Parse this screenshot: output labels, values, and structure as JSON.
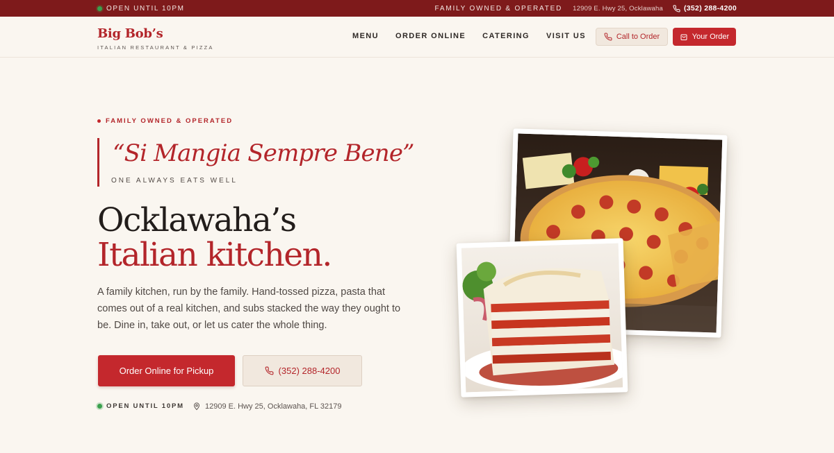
{
  "topbar": {
    "status": "OPEN UNTIL 10PM",
    "tagline": "FAMILY OWNED & OPERATED",
    "address": "12909 E. Hwy 25, Ocklawaha",
    "phone": "(352) 288-4200"
  },
  "brand": {
    "name": "Big Bob’s",
    "subtitle": "ITALIAN RESTAURANT & PIZZA"
  },
  "nav": {
    "items": [
      "MENU",
      "ORDER ONLINE",
      "CATERING",
      "VISIT US"
    ],
    "call_label": "Call to Order",
    "order_label": "Your Order"
  },
  "hero": {
    "eyebrow": "FAMILY OWNED & OPERATED",
    "quote": "“Si Mangia Sempre Bene”",
    "quote_translation": "ONE ALWAYS EATS WELL",
    "headline_line1": "Ocklawaha’s",
    "headline_line2": "Italian kitchen.",
    "body": "A family kitchen, run by the family. Hand-tossed pizza, pasta that comes out of a real kitchen, and subs stacked the way they ought to be. Dine in, take out, or let us cater the whole thing.",
    "cta_primary": "Order Online for Pickup",
    "cta_phone": "(352) 288-4200",
    "status": "OPEN UNTIL 10PM",
    "address": "12909 E. Hwy 25, Ocklawaha, FL 32179"
  },
  "colors": {
    "brand_red": "#b3252a",
    "topbar": "#7e1a1b",
    "background": "#faf6f0",
    "open_green": "#3aa04d"
  },
  "icons": [
    "phone-icon",
    "bag-icon",
    "map-pin-icon"
  ]
}
